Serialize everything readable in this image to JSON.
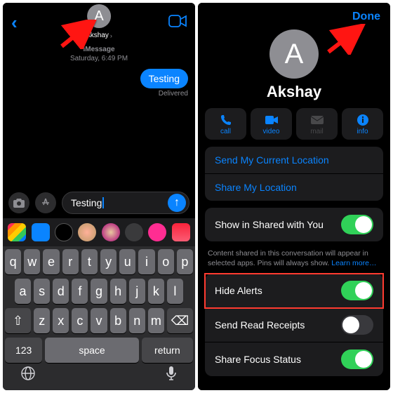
{
  "colors": {
    "accent": "#0a84ff",
    "green": "#30d158",
    "red": "#ff3b30"
  },
  "left": {
    "contact": "Akshay",
    "avatar_initial": "A",
    "thread": {
      "service": "iMessage",
      "timestamp": "Saturday, 6:49 PM",
      "bubble": "Testing",
      "status": "Delivered"
    },
    "composer": {
      "text": "Testing"
    },
    "keyboard": {
      "r1": [
        "q",
        "w",
        "e",
        "r",
        "t",
        "y",
        "u",
        "i",
        "o",
        "p"
      ],
      "r2": [
        "a",
        "s",
        "d",
        "f",
        "g",
        "h",
        "j",
        "k",
        "l"
      ],
      "r3": [
        "z",
        "x",
        "c",
        "v",
        "b",
        "n",
        "m"
      ],
      "shift": "⇧",
      "del": "⌫",
      "numkey": "123",
      "space": "space",
      "ret": "return",
      "globe": "🌐",
      "mic": "🎤"
    },
    "icons": {
      "back": "‹",
      "camera": "camera-icon",
      "cam_btn": "📷",
      "appstore": "Ⓐ"
    }
  },
  "right": {
    "done": "Done",
    "avatar_initial": "A",
    "name": "Akshay",
    "actions": {
      "call": "call",
      "video": "video",
      "mail": "mail",
      "info": "info"
    },
    "location": {
      "send": "Send My Current Location",
      "share": "Share My Location"
    },
    "shared": {
      "label": "Show in Shared with You",
      "desc": "Content shared in this conversation will appear in selected apps. Pins will always show. ",
      "learn": "Learn more…",
      "on": true
    },
    "settings": {
      "hide_alerts": {
        "label": "Hide Alerts",
        "on": true
      },
      "read_receipts": {
        "label": "Send Read Receipts",
        "on": false
      },
      "focus": {
        "label": "Share Focus Status",
        "on": true
      }
    }
  }
}
